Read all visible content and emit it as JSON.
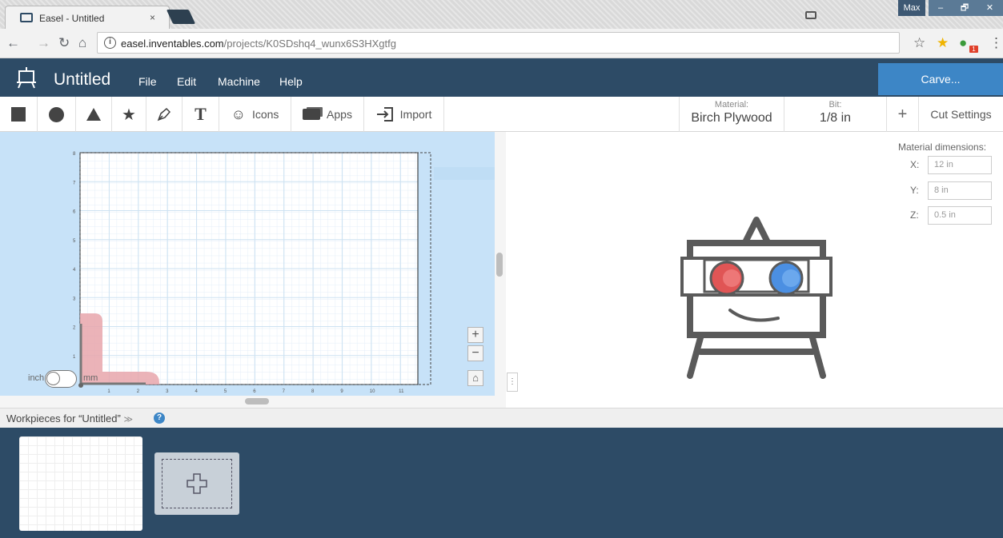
{
  "browser": {
    "tab_title": "Easel - Untitled",
    "tab_close": "×",
    "url_host": "easel.inventables.com",
    "url_path": "/projects/K0SDshq4_wunx6S3HXgtfg",
    "window_user": "Max",
    "win_min": "–",
    "win_restore": "🗗",
    "win_close": "✕",
    "ext_badge": "1"
  },
  "app": {
    "title": "Untitled",
    "menu": [
      "File",
      "Edit",
      "Machine",
      "Help"
    ],
    "carve_label": "Carve..."
  },
  "shapes_toolbar": {
    "icons_label": "Icons",
    "apps_label": "Apps",
    "import_label": "Import",
    "material_label": "Material:",
    "material_value": "Birch Plywood",
    "bit_label": "Bit:",
    "bit_value": "1/8 in",
    "plus": "+",
    "cut_settings_label": "Cut Settings"
  },
  "canvas": {
    "y_ticks": [
      "8",
      "7",
      "6",
      "5",
      "4",
      "3",
      "2",
      "1"
    ],
    "x_ticks": [
      "1",
      "2",
      "3",
      "4",
      "5",
      "6",
      "7",
      "8",
      "9",
      "10",
      "11"
    ],
    "unit_left": "inch",
    "unit_right": "mm",
    "zoom_in": "+",
    "zoom_out": "−",
    "home": "⌂"
  },
  "preview": {
    "dimensions_title": "Material dimensions:",
    "x_label": "X:",
    "x_value": "12 in",
    "y_label": "Y:",
    "y_value": "8 in",
    "z_label": "Z:",
    "z_value": "0.5 in",
    "handle": "⋮"
  },
  "workpieces": {
    "title": "Workpieces for “Untitled”",
    "collapse_icon": "≫",
    "help": "?"
  },
  "colors": {
    "brand_dark": "#2d4b66",
    "carve_blue": "#3d86c6",
    "canvas_blue": "#c7e2f8",
    "glasses_red": "#e05555",
    "glasses_blue": "#4b8fe2"
  }
}
